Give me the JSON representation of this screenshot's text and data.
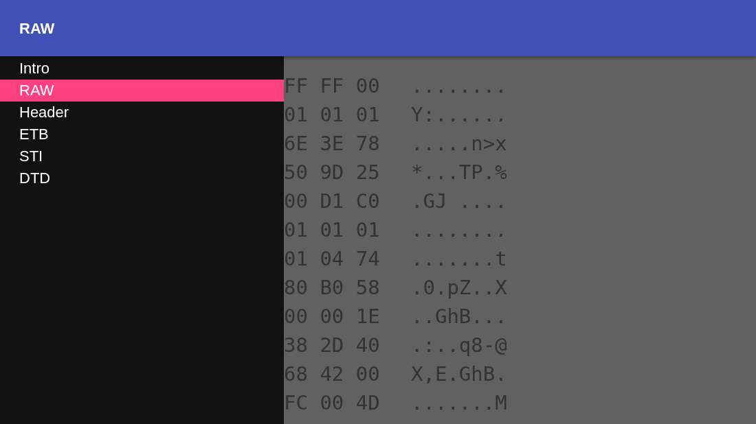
{
  "app_bar": {
    "title": "RAW"
  },
  "sidebar": {
    "items": [
      {
        "label": "Intro",
        "selected": false
      },
      {
        "label": "RAW",
        "selected": true
      },
      {
        "label": "Header",
        "selected": false
      },
      {
        "label": "ETB",
        "selected": false
      },
      {
        "label": "STI",
        "selected": false
      },
      {
        "label": "DTD",
        "selected": false
      }
    ]
  },
  "hex_dump": {
    "rows": [
      {
        "hex": "FF FF 00",
        "ascii": "........"
      },
      {
        "hex": "01 01 01",
        "ascii": "Y:......"
      },
      {
        "hex": "6E 3E 78",
        "ascii": ".....n>x"
      },
      {
        "hex": "50 9D 25",
        "ascii": "*...TP.%"
      },
      {
        "hex": "00 D1 C0",
        "ascii": ".GJ ...."
      },
      {
        "hex": "01 01 01",
        "ascii": "........"
      },
      {
        "hex": "01 04 74",
        "ascii": ".......t"
      },
      {
        "hex": "80 B0 58",
        "ascii": ".0.pZ..X"
      },
      {
        "hex": "00 00 1E",
        "ascii": "..GhB..."
      },
      {
        "hex": "38 2D 40",
        "ascii": ".:..q8-@"
      },
      {
        "hex": "68 42 00",
        "ascii": "X,E.GhB."
      },
      {
        "hex": "FC 00 4D",
        "ascii": ".......M"
      }
    ]
  }
}
